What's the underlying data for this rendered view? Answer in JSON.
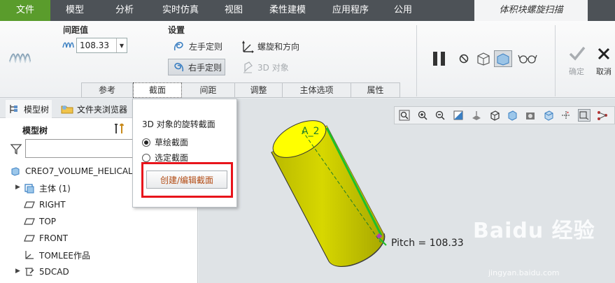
{
  "menu": {
    "items": [
      "文件",
      "模型",
      "分析",
      "实时仿真",
      "视图",
      "柔性建模",
      "应用程序",
      "公用"
    ],
    "active_tab": "体积块螺旋扫描"
  },
  "ribbon": {
    "pitch_group_label": "间距值",
    "pitch_value": "108.33",
    "settings_label": "设置",
    "left_hand": "左手定则",
    "right_hand": "右手定则",
    "helix_direction": "螺旋和方向",
    "object_3d": "3D 对象",
    "tabs": [
      "参考",
      "截面",
      "间距",
      "调整",
      "主体选项",
      "属性"
    ],
    "active_tab_index": 1,
    "ok_label": "确定",
    "cancel_label": "取消"
  },
  "left_panel": {
    "tab_model_tree": "模型树",
    "tab_folder_browser": "文件夹浏览器",
    "tree_title": "模型树",
    "filter_placeholder": "",
    "items": [
      {
        "label": "CREO7_VOLUME_HELICAL_"
      },
      {
        "label": "主体 (1)"
      },
      {
        "label": "RIGHT"
      },
      {
        "label": "TOP"
      },
      {
        "label": "FRONT"
      },
      {
        "label": "TOMLEE作品"
      },
      {
        "label": "5DCAD"
      }
    ]
  },
  "popup": {
    "title": "3D 对象的旋转截面",
    "option_sketch": "草绘截面",
    "option_selected": "选定截面",
    "selected_option": "sketch",
    "create_button": "创建/编辑截面"
  },
  "graphics": {
    "axis_label": "A_2",
    "pitch_annotation": "Pitch = 108.33",
    "watermark": "Baidu 经验",
    "watermark_url": "jingyan.baidu.com",
    "colors": {
      "cylinder_fill": "#c8c800",
      "cylinder_top": "#ffff00",
      "axis_green": "#1dbf2a",
      "pitch_marker": "#b040b0"
    }
  },
  "colors": {
    "file_menu": "#5a9c2c",
    "menubar": "#4d5257",
    "highlight_red": "#e8141b"
  }
}
